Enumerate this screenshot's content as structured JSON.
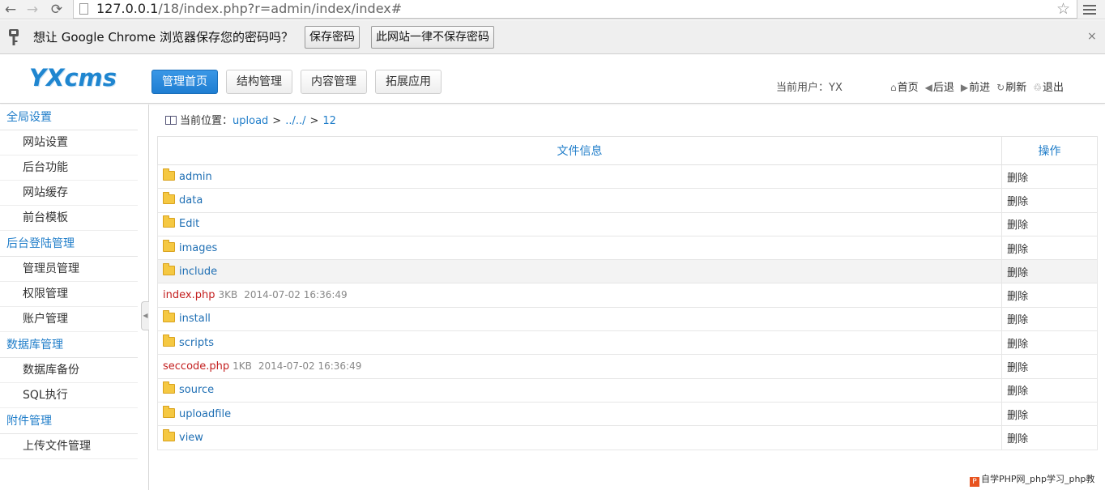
{
  "browser": {
    "url_host": "127.0.0.1",
    "url_path": "/18/index.php?r=admin/index/index#",
    "password_prompt": "想让 Google Chrome 浏览器保存您的密码吗？",
    "save_password_label": "保存密码",
    "never_save_label": "此网站一律不保存密码",
    "close_label": "×"
  },
  "header": {
    "logo": "YXcms",
    "nav": [
      {
        "label": "管理首页",
        "active": true
      },
      {
        "label": "结构管理",
        "active": false
      },
      {
        "label": "内容管理",
        "active": false
      },
      {
        "label": "拓展应用",
        "active": false
      }
    ],
    "current_user": "当前用户：YX",
    "links": [
      {
        "label": "首页",
        "icon": "home-icon"
      },
      {
        "label": "后退",
        "icon": "back-arrow-icon"
      },
      {
        "label": "前进",
        "icon": "forward-arrow-icon"
      },
      {
        "label": "刷新",
        "icon": "refresh-icon"
      },
      {
        "label": "退出",
        "icon": "logout-icon"
      }
    ]
  },
  "sidebar": {
    "groups": [
      {
        "title": "全局设置",
        "items": [
          "网站设置",
          "后台功能",
          "网站缓存",
          "前台模板"
        ]
      },
      {
        "title": "后台登陆管理",
        "items": [
          "管理员管理",
          "权限管理",
          "账户管理"
        ]
      },
      {
        "title": "数据库管理",
        "items": [
          "数据库备份",
          "SQL执行"
        ]
      },
      {
        "title": "附件管理",
        "items": [
          "上传文件管理"
        ]
      }
    ]
  },
  "breadcrumb": {
    "label": "当前位置：",
    "parts": [
      "upload",
      "../../",
      "12"
    ],
    "sep": ">"
  },
  "table": {
    "headers": [
      "文件信息",
      "操作"
    ],
    "rows": [
      {
        "type": "folder",
        "name": "admin",
        "size": "",
        "date": "",
        "op": "删除"
      },
      {
        "type": "folder",
        "name": "data",
        "size": "",
        "date": "",
        "op": "删除"
      },
      {
        "type": "folder",
        "name": "Edit",
        "size": "",
        "date": "",
        "op": "删除"
      },
      {
        "type": "folder",
        "name": "images",
        "size": "",
        "date": "",
        "op": "删除"
      },
      {
        "type": "folder",
        "name": "include",
        "size": "",
        "date": "",
        "op": "删除",
        "highlight": true
      },
      {
        "type": "file",
        "name": "index.php",
        "size": "3KB",
        "date": "2014-07-02 16:36:49",
        "op": "删除"
      },
      {
        "type": "folder",
        "name": "install",
        "size": "",
        "date": "",
        "op": "删除"
      },
      {
        "type": "folder",
        "name": "scripts",
        "size": "",
        "date": "",
        "op": "删除"
      },
      {
        "type": "file",
        "name": "seccode.php",
        "size": "1KB",
        "date": "2014-07-02 16:36:49",
        "op": "删除"
      },
      {
        "type": "folder",
        "name": "source",
        "size": "",
        "date": "",
        "op": "删除"
      },
      {
        "type": "folder",
        "name": "uploadfile",
        "size": "",
        "date": "",
        "op": "删除"
      },
      {
        "type": "folder",
        "name": "view",
        "size": "",
        "date": "",
        "op": "删除"
      }
    ]
  },
  "watermark": "自学PHP网_php学习_php教"
}
